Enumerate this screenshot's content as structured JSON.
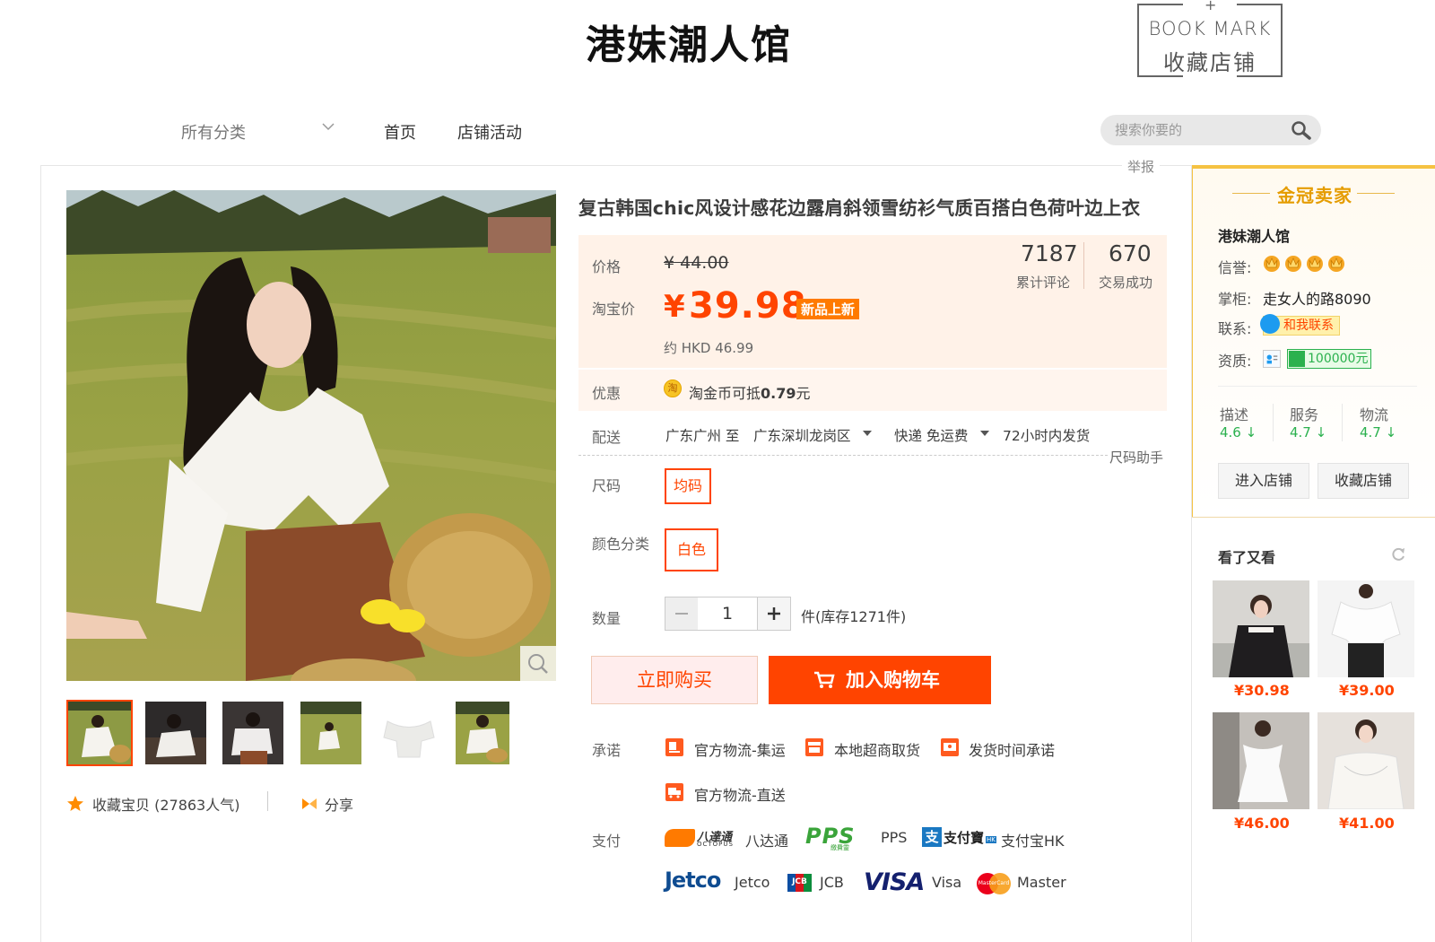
{
  "header": {
    "shop_name": "港妹潮人馆",
    "bookmark_en": "BOOK MARK",
    "bookmark_cn": "收藏店铺"
  },
  "nav": {
    "all_categories": "所有分类",
    "home": "首页",
    "activities": "店铺活动",
    "search_placeholder": "搜索你要的"
  },
  "report": "举报",
  "gallery": {
    "favorite_label": "收藏宝贝 (27863人气)",
    "share_label": "分享",
    "thumbnail_count": 6
  },
  "product": {
    "title": "复古韩国chic风设计感花边露肩斜领雪纺衫气质百搭白色荷叶边上衣",
    "price_label": "价格",
    "original_price": "¥ 44.00",
    "taobao_price_label": "淘宝价",
    "yen": "¥",
    "current_price": "39.98",
    "new_badge": "新品上新",
    "hkd_price": "约 HKD 46.99",
    "reviews_count": "7187",
    "reviews_label": "累计评论",
    "deals_count": "670",
    "deals_label": "交易成功",
    "promo_label": "优惠",
    "coin_icon_text": "淘",
    "promo_text_prefix": "淘金币可抵",
    "promo_amount": "0.79",
    "promo_unit": "元",
    "shipping_label": "配送",
    "ship_from": "广东广州 至",
    "ship_to": "广东深圳龙岗区",
    "ship_method": "快递 免运费",
    "ship_time": "72小时内发货",
    "size_helper": "尺码助手",
    "size_label": "尺码",
    "size_option": "均码",
    "color_label": "颜色分类",
    "color_option": "白色",
    "qty_label": "数量",
    "qty_value": "1",
    "stock_text": "件(库存1271件)",
    "buy_now": "立即购买",
    "add_cart": "加入购物车",
    "promise_label": "承诺",
    "promises": [
      "官方物流-集运",
      "本地超商取货",
      "发货时间承诺",
      "官方物流-直送"
    ],
    "payment_label": "支付",
    "payments": [
      "八达通",
      "PPS",
      "支付宝HK",
      "Jetco",
      "JCB",
      "Visa",
      "Master"
    ],
    "payment_logos": {
      "octopus_cn": "八達通",
      "octopus_en": "OCTOPUS",
      "pps": "PPS",
      "pps_sub": "繳費靈",
      "alipay": "支付寶",
      "alipay_hk": "HK",
      "jetco": "Jetco",
      "jcb": "JCB",
      "visa": "VISA",
      "mastercard": "MasterCard"
    }
  },
  "seller": {
    "badge_title": "金冠卖家",
    "shop_name": "港妹潮人馆",
    "credit_label": "信誉:",
    "crown_count": 4,
    "owner_label": "掌柜:",
    "owner_name": "走女人的路8090",
    "contact_label": "联系:",
    "contact_button": "和我联系",
    "qualification_label": "资质:",
    "deposit": "100000元",
    "ratings": [
      {
        "label": "描述",
        "value": "4.6 ↓"
      },
      {
        "label": "服务",
        "value": "4.7 ↓"
      },
      {
        "label": "物流",
        "value": "4.7 ↓"
      }
    ],
    "enter_shop": "进入店铺",
    "favorite_shop": "收藏店铺"
  },
  "recommend": {
    "title": "看了又看",
    "items": [
      {
        "price": "¥30.98"
      },
      {
        "price": "¥39.00"
      },
      {
        "price": "¥46.00"
      },
      {
        "price": "¥41.00"
      }
    ]
  },
  "colors": {
    "accent": "#ff4400",
    "price_bg": "#fff2e8",
    "gold": "#e59c00",
    "rating_green": "#2bb14e"
  }
}
